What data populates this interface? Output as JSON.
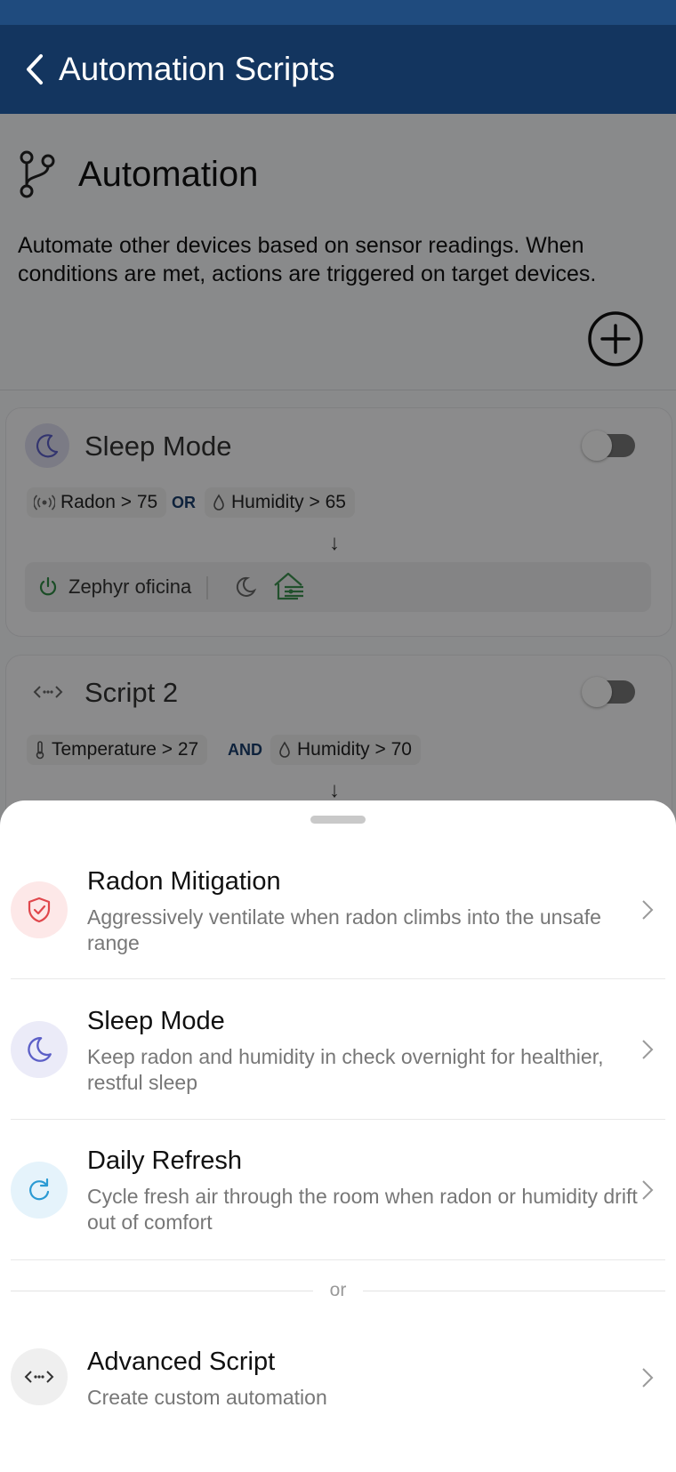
{
  "appbar": {
    "title": "Automation Scripts"
  },
  "header": {
    "title": "Automation",
    "description": "Automate other devices based on sensor readings. When conditions are met, actions are triggered on target devices."
  },
  "scripts": [
    {
      "title": "Sleep Mode",
      "enabled": false,
      "conditions": [
        {
          "sensor": "Radon",
          "text": "Radon > 75"
        },
        {
          "sensor": "Humidity",
          "text": "Humidity > 65"
        }
      ],
      "logic": "OR",
      "action_device": "Zephyr oficina"
    },
    {
      "title": "Script 2",
      "enabled": false,
      "conditions": [
        {
          "sensor": "Temperature",
          "text": "Temperature > 27"
        },
        {
          "sensor": "Humidity",
          "text": "Humidity > 70"
        }
      ],
      "logic": "AND"
    }
  ],
  "sheet": {
    "options": [
      {
        "title": "Radon Mitigation",
        "description": "Aggressively ventilate when radon climbs into the unsafe range",
        "icon": "shield-check-icon"
      },
      {
        "title": "Sleep Mode",
        "description": "Keep radon and humidity in check overnight for healthier, restful sleep",
        "icon": "moon-icon"
      },
      {
        "title": "Daily Refresh",
        "description": "Cycle fresh air through the room when radon or humidity drift out of comfort",
        "icon": "refresh-icon"
      }
    ],
    "or_label": "or",
    "advanced": {
      "title": "Advanced Script",
      "description": "Create custom automation",
      "icon": "code-icon"
    }
  },
  "colors": {
    "appbar": "#13355f",
    "statusbar": "#1f4b7e",
    "radon_accent": "#e0474c",
    "sleep_accent": "#5c5fc7",
    "refresh_accent": "#2b9ad3",
    "fan_green": "#3c8f4f"
  }
}
